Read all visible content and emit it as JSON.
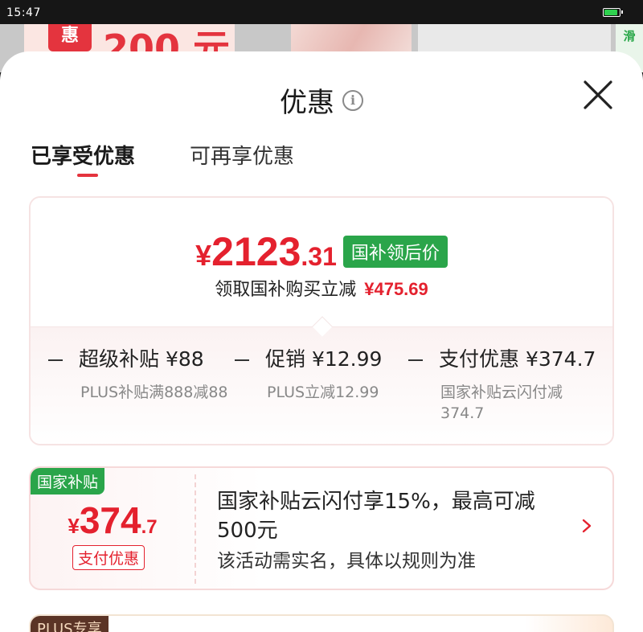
{
  "status_bar": {
    "time": "15:47"
  },
  "background_page": {
    "banner_badge": "惠",
    "banner_amount": "200 元",
    "side_text": "滑"
  },
  "sheet": {
    "title": "优惠",
    "tabs": [
      {
        "label": "已享受优惠",
        "active": true
      },
      {
        "label": "可再享优惠",
        "active": false
      }
    ]
  },
  "summary": {
    "price_currency": "¥",
    "price_int": "2123",
    "price_dec": ".31",
    "price_badge": "国补领后价",
    "subtext": "领取国补购买立减",
    "subtext_amount": "¥475.69",
    "discounts": [
      {
        "label": "超级补贴 ¥88",
        "desc": "PLUS补贴满888减88"
      },
      {
        "label": "促销 ¥12.99",
        "desc": "PLUS立减12.99"
      },
      {
        "label": "支付优惠 ¥374.7",
        "desc": "国家补贴云闪付减374.7"
      }
    ]
  },
  "subsidy_card": {
    "tag": "国家补贴",
    "price_currency": "¥",
    "price_int": "374",
    "price_dec": ".7",
    "chip": "支付优惠",
    "title": "国家补贴云闪付享15%，最高可减500元",
    "note": "该活动需实名，具体以规则为准"
  },
  "next_card": {
    "tag": "PLUS专享"
  },
  "colors": {
    "accent_red": "#e4212e",
    "badge_green": "#2aa54a",
    "plus_brown": "#5b3426"
  }
}
